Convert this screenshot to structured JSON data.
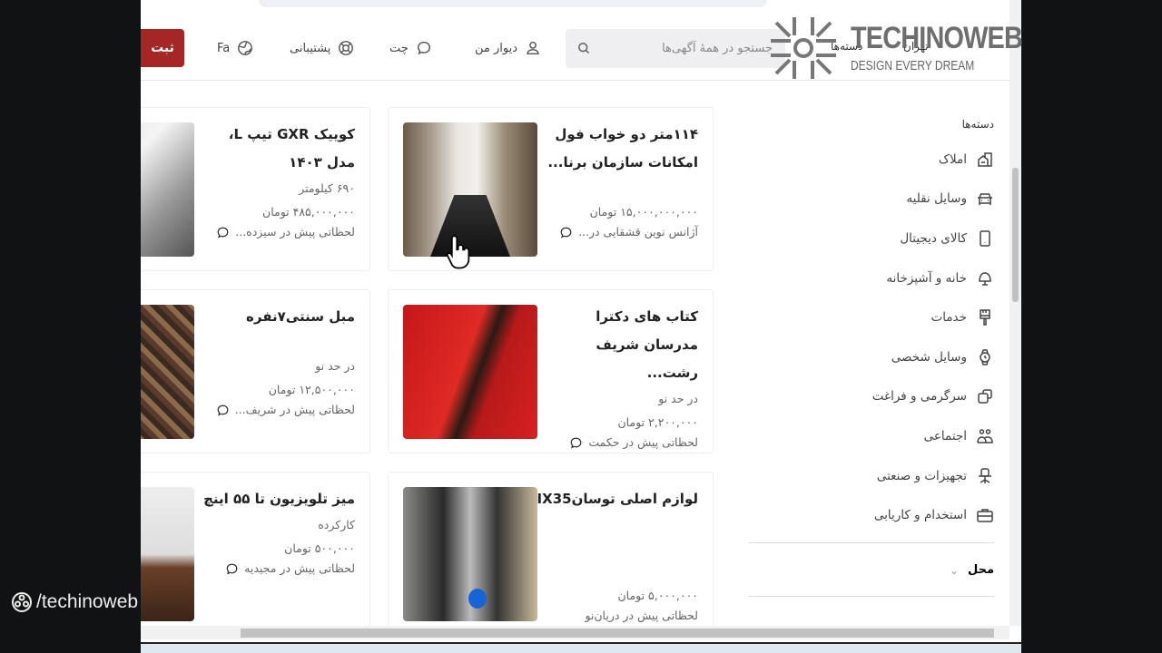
{
  "header": {
    "submit_label": "ثبت",
    "language_label": "Fa",
    "support_label": "پشتیبانی",
    "chat_label": "چت",
    "my_divar_label": "دیوار من",
    "search_placeholder": "جستجو در همهٔ آگهی‌ها",
    "categories_label": "دسته‌ها",
    "city_label": "تهران"
  },
  "listings": [
    {
      "title": "۱۱۴متر دو خواب فول امکانات سازمان برنا...",
      "meta": "",
      "price": "۱۵,۰۰۰,۰۰۰,۰۰۰ تومان",
      "location": "آژانس نوین قشقایی در..."
    },
    {
      "title": "کوییک GXR تیپ L، مدل ۱۴۰۳",
      "meta": "۶۹۰ کیلومتر",
      "price": "۴۸۵,۰۰۰,۰۰۰ تومان",
      "location": "لحظاتی پیش در سیزده..."
    },
    {
      "title": "کتاب های دکترا مدرسان شریف رشت...",
      "meta": "در حد نو",
      "price": "۲,۲۰۰,۰۰۰ تومان",
      "location": "لحظاتی پیش در حکمت"
    },
    {
      "title": "مبل سنتی۷نفره",
      "meta": "در حد نو",
      "price": "۱۲,۵۰۰,۰۰۰ تومان",
      "location": "لحظاتی پیش در شریف..."
    },
    {
      "title": "لوازم اصلی توسانIX35",
      "meta": "",
      "price": "۵,۰۰۰,۰۰۰ تومان",
      "location": "لحظاتی پیش در دریان‌نو"
    },
    {
      "title": "میز تلویزیون تا ۵۵ اینچ",
      "meta": "کارکرده",
      "price": "۵۰۰,۰۰۰ تومان",
      "location": "لحظاتی پیش در مجیدیه"
    }
  ],
  "sidebar": {
    "heading": "دسته‌ها",
    "items": [
      {
        "label": "املاک",
        "icon": "building-icon"
      },
      {
        "label": "وسایل نقلیه",
        "icon": "car-icon"
      },
      {
        "label": "کالای دیجیتال",
        "icon": "mobile-icon"
      },
      {
        "label": "خانه و آشپزخانه",
        "icon": "lamp-icon"
      },
      {
        "label": "خدمات",
        "icon": "brush-icon"
      },
      {
        "label": "وسایل شخصی",
        "icon": "watch-icon"
      },
      {
        "label": "سرگرمی و فراغت",
        "icon": "dice-icon"
      },
      {
        "label": "اجتماعی",
        "icon": "people-icon"
      },
      {
        "label": "تجهیزات و صنعتی",
        "icon": "chair-icon"
      },
      {
        "label": "استخدام و کاریابی",
        "icon": "briefcase-icon"
      }
    ],
    "location_label": "محل"
  },
  "watermark": {
    "title": "TECHINOWEB",
    "subtitle": "DESIGN EVERY DREAM",
    "social": "/techinoweb"
  },
  "colors": {
    "brand": "#a62626"
  }
}
